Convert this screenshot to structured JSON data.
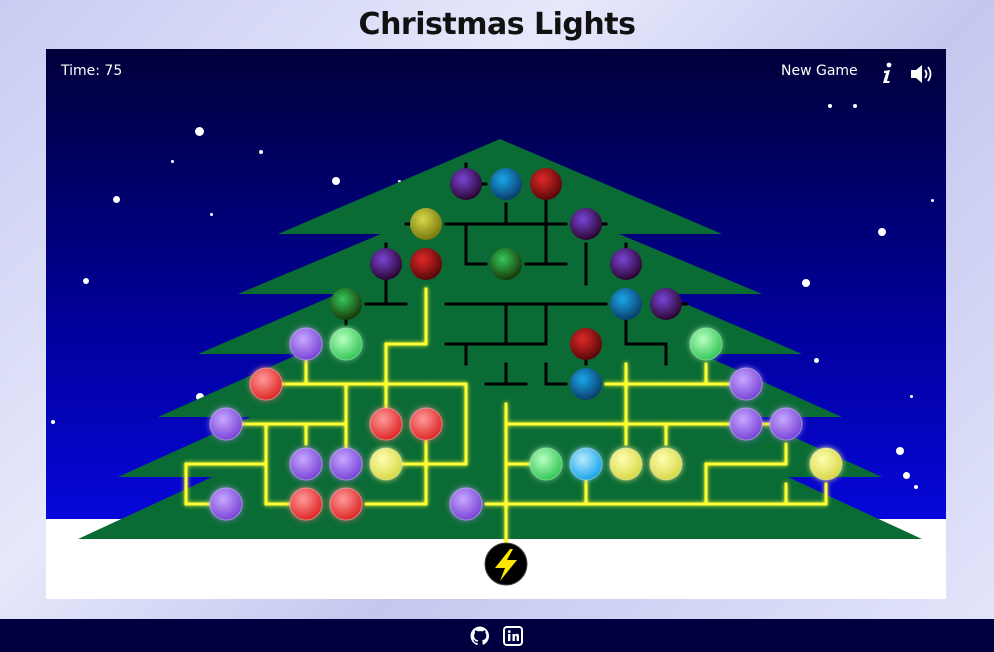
{
  "title": "Christmas Lights",
  "hud": {
    "time_label": "Time: 75",
    "new_game_label": "New Game",
    "info_icon": "info-icon",
    "sound_icon": "speaker-icon"
  },
  "footer": {
    "github_icon": "github-icon",
    "linkedin_icon": "linkedin-icon"
  },
  "colors": {
    "sky_top": "#00003a",
    "sky_bottom": "#0a0af5",
    "tree": "#0b6b35",
    "wire_lit": "#ffff33",
    "wire_off": "#000000",
    "trunk": "#5b3a1d",
    "power": "#ffe600"
  },
  "game": {
    "power_source": "lightning-bolt-icon",
    "bulbs": [
      {
        "color": "purple",
        "lit": false
      },
      {
        "color": "blue",
        "lit": false
      },
      {
        "color": "red",
        "lit": false
      },
      {
        "color": "yellow",
        "lit": false
      },
      {
        "color": "purple",
        "lit": false
      },
      {
        "color": "purple",
        "lit": false
      },
      {
        "color": "red",
        "lit": false
      },
      {
        "color": "green",
        "lit": false
      },
      {
        "color": "purple",
        "lit": false
      },
      {
        "color": "green",
        "lit": false
      },
      {
        "color": "blue",
        "lit": false
      },
      {
        "color": "purple",
        "lit": false
      },
      {
        "color": "purple",
        "lit": true
      },
      {
        "color": "green",
        "lit": true
      },
      {
        "color": "red",
        "lit": false
      },
      {
        "color": "green",
        "lit": true
      },
      {
        "color": "red",
        "lit": true
      },
      {
        "color": "blue",
        "lit": false
      },
      {
        "color": "purple",
        "lit": true
      },
      {
        "color": "purple",
        "lit": true
      },
      {
        "color": "red",
        "lit": true
      },
      {
        "color": "red",
        "lit": true
      },
      {
        "color": "purple",
        "lit": true
      },
      {
        "color": "purple",
        "lit": true
      },
      {
        "color": "purple",
        "lit": true
      },
      {
        "color": "purple",
        "lit": true
      },
      {
        "color": "yellow",
        "lit": true
      },
      {
        "color": "green",
        "lit": true
      },
      {
        "color": "blue",
        "lit": true
      },
      {
        "color": "yellow",
        "lit": true
      },
      {
        "color": "yellow",
        "lit": true
      },
      {
        "color": "yellow",
        "lit": true
      },
      {
        "color": "purple",
        "lit": true
      },
      {
        "color": "red",
        "lit": true
      },
      {
        "color": "red",
        "lit": true
      },
      {
        "color": "purple",
        "lit": true
      }
    ]
  }
}
